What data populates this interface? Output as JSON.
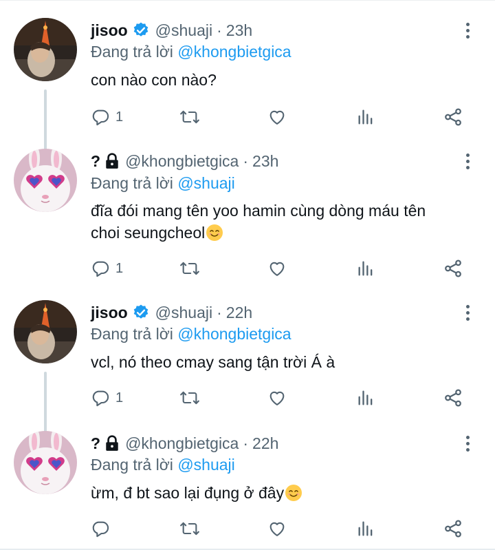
{
  "colors": {
    "accent": "#1d9bf0",
    "muted": "#536471",
    "text": "#0f1419",
    "thread_line": "#cfd9de"
  },
  "tweets": [
    {
      "name": "jisoo",
      "verified": true,
      "locked": false,
      "handle": "@shuaji",
      "dot": "·",
      "time": "23h",
      "replying_prefix": "Đang trả lời",
      "replying_to": "@khongbietgica",
      "text_line1": "con nào con nào?",
      "reply_count": "1",
      "avatar": "night-tower-portrait"
    },
    {
      "name": "?",
      "verified": false,
      "locked": true,
      "handle": "@khongbietgica",
      "dot": "·",
      "time": "23h",
      "replying_prefix": "Đang trả lời",
      "replying_to": "@shuaji",
      "text_line1": "đĩa đói mang tên yoo hamin cùng dòng máu tên",
      "text_line2": "choi seungcheol",
      "reply_count": "1",
      "avatar": "bunny-heart-glasses"
    },
    {
      "name": "jisoo",
      "verified": true,
      "locked": false,
      "handle": "@shuaji",
      "dot": "·",
      "time": "22h",
      "replying_prefix": "Đang trả lời",
      "replying_to": "@khongbietgica",
      "text_line1": "vcl, nó theo cmay sang tận trời Á à",
      "reply_count": "1",
      "avatar": "night-tower-portrait"
    },
    {
      "name": "?",
      "verified": false,
      "locked": true,
      "handle": "@khongbietgica",
      "dot": "·",
      "time": "22h",
      "replying_prefix": "Đang trả lời",
      "replying_to": "@shuaji",
      "text_line1": "ừm, đ bt sao lại đụng ở đây",
      "reply_count": "",
      "avatar": "bunny-heart-glasses"
    }
  ],
  "icons": [
    "reply-icon",
    "retweet-icon",
    "like-icon",
    "analytics-icon",
    "share-icon",
    "more-icon",
    "verified-icon",
    "lock-icon",
    "smiling-emoji"
  ]
}
